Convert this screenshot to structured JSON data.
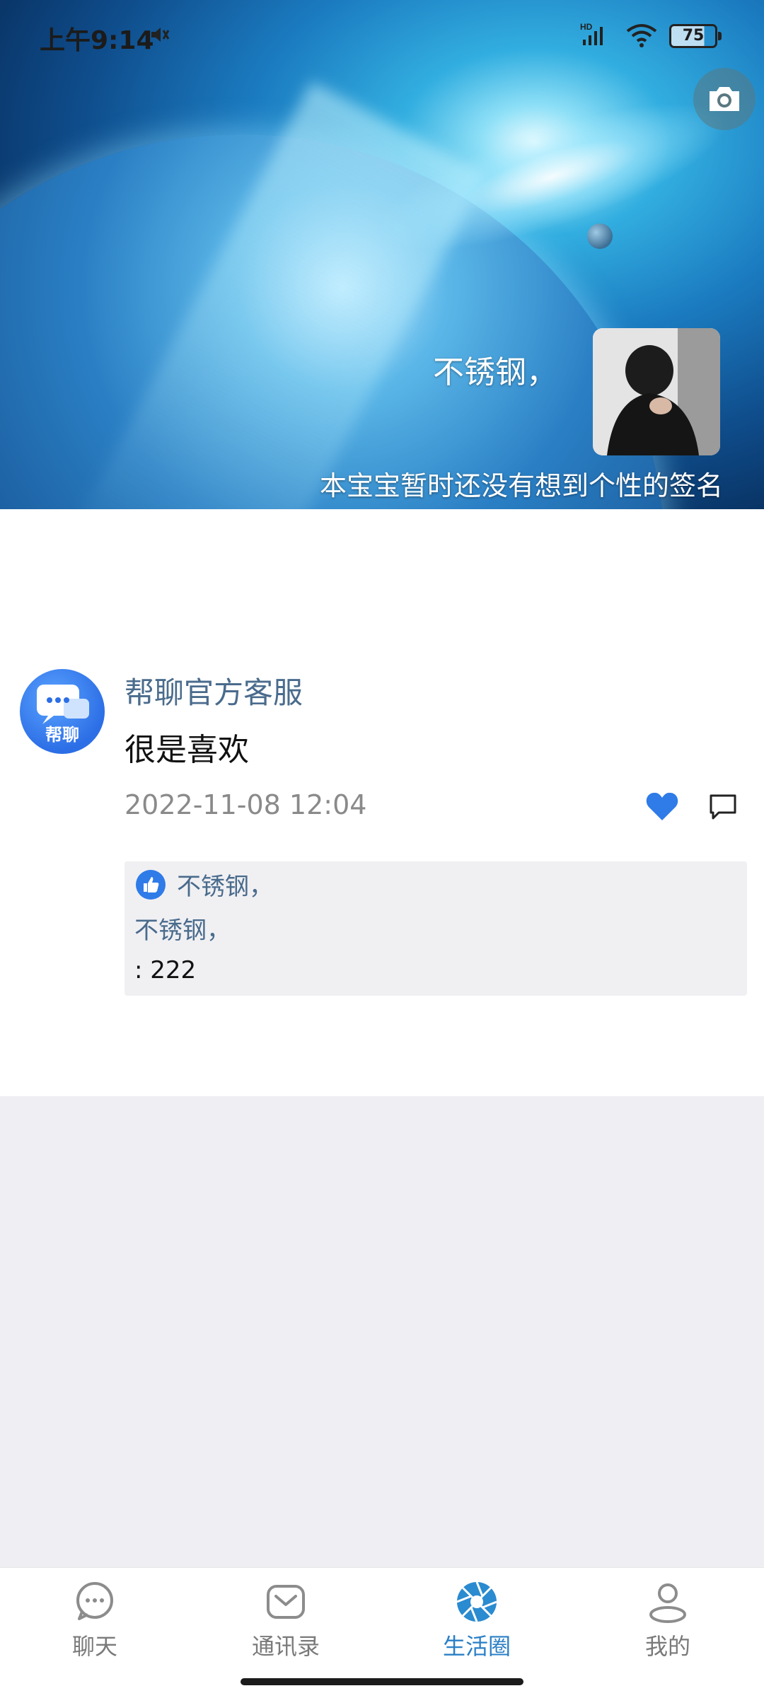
{
  "status_bar": {
    "time": "上午9:14",
    "battery": "75"
  },
  "profile": {
    "name": "不锈钢，",
    "signature": "本宝宝暂时还没有想到个性的签名"
  },
  "post": {
    "author": "帮聊官方客服",
    "avatar_label": "帮聊",
    "content": "很是喜欢",
    "time": "2022-11-08 12:04",
    "likes": "不锈钢，",
    "comment_author": "不锈钢，",
    "comment_text": ": 222"
  },
  "tabs": [
    {
      "label": "聊天",
      "icon": "chat-bubble-icon"
    },
    {
      "label": "通讯录",
      "icon": "contacts-mail-icon"
    },
    {
      "label": "生活圈",
      "icon": "aperture-icon"
    },
    {
      "label": "我的",
      "icon": "person-icon"
    }
  ],
  "colors": {
    "accent": "#2a7fc6",
    "name_link": "#4a6b8c",
    "like": "#2f7be8",
    "background": "#efeff3"
  }
}
